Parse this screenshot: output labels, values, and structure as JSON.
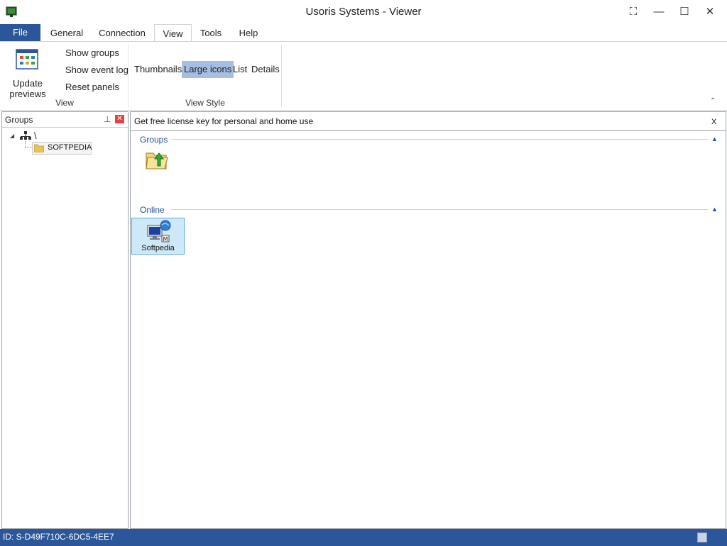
{
  "window": {
    "title": "Usoris Systems - Viewer"
  },
  "ribbon": {
    "file_label": "File",
    "tabs": [
      "General",
      "Connection",
      "View",
      "Tools",
      "Help"
    ],
    "view_group": {
      "update_previews_line1": "Update",
      "update_previews_line2": "previews",
      "items": [
        "Show groups",
        "Show event log",
        "Reset panels"
      ],
      "label": "View"
    },
    "view_style_group": {
      "items": [
        "Thumbnails",
        "Large icons",
        "List",
        "Details"
      ],
      "selected": "Large icons",
      "label": "View Style"
    }
  },
  "groups_panel": {
    "title": "Groups",
    "tree": {
      "root": "\\",
      "child": "SOFTPEDIA"
    }
  },
  "main": {
    "license_text": "Get free license key for personal and home use",
    "close_label": "X",
    "sections": [
      {
        "title": "Groups"
      },
      {
        "title": "Online",
        "items": [
          {
            "label": "Softpedia"
          }
        ]
      }
    ]
  },
  "status": {
    "id_text": "ID: S-D49F710C-6DC5-4EE7"
  },
  "colors": {
    "accent": "#2b579a",
    "selected": "#a4bfe3",
    "item_selected_bg": "#cde8f7"
  }
}
